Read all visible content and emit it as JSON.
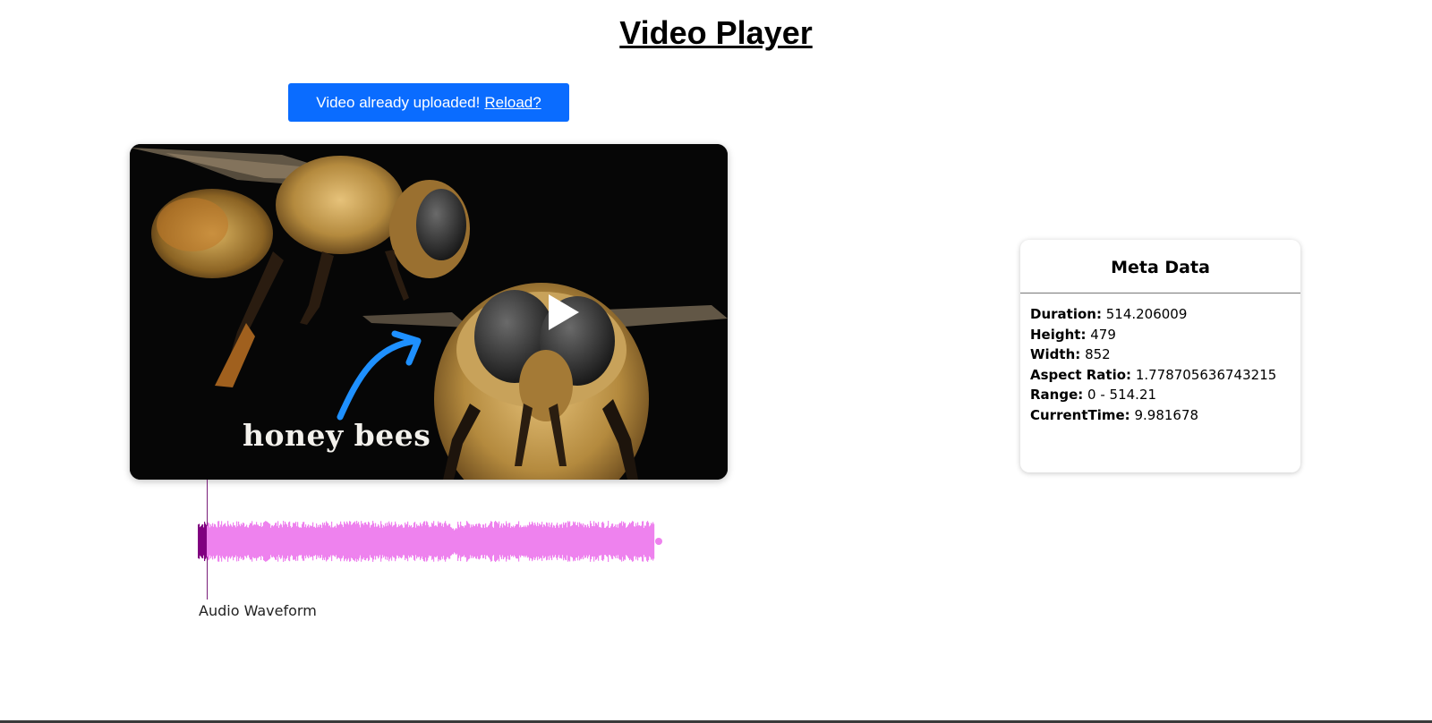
{
  "page": {
    "title": "Video Player"
  },
  "banner": {
    "message": "Video already uploaded!",
    "reload_label": "Reload?"
  },
  "video": {
    "caption": "honey bees",
    "current_time": 9.981678,
    "duration": 514.206009
  },
  "waveform": {
    "label": "Audio Waveform",
    "progress_fraction": 0.0194,
    "wave_color": "#ee82ee",
    "played_color": "#800080"
  },
  "meta": {
    "title": "Meta Data",
    "rows": [
      {
        "key": "Duration:",
        "value": "514.206009"
      },
      {
        "key": "Height:",
        "value": "479"
      },
      {
        "key": "Width:",
        "value": "852"
      },
      {
        "key": "Aspect Ratio:",
        "value": "1.778705636743215"
      },
      {
        "key": "Range:",
        "value": "0 - 514.21"
      },
      {
        "key": "CurrentTime:",
        "value": "9.981678"
      }
    ]
  },
  "colors": {
    "banner_bg": "#0a6cff",
    "accent_arrow": "#1e90ff"
  }
}
